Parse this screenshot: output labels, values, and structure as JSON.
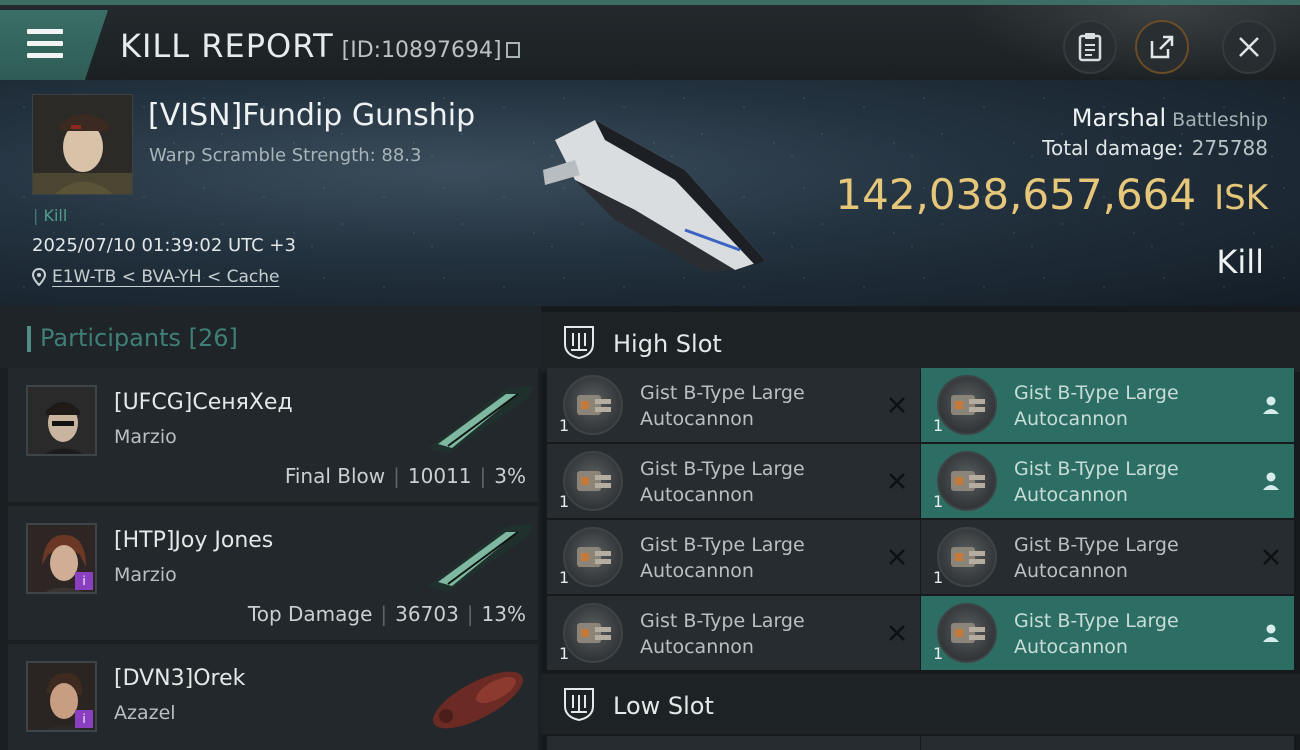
{
  "header": {
    "title": "KILL REPORT",
    "kill_id": "[ID:10897694]"
  },
  "victim": {
    "name": "[VISN]Fundip Gunship",
    "warp_scramble": "Warp Scramble Strength: 88.3",
    "tag": "Kill",
    "datetime": "2025/07/10 01:39:02 UTC +3",
    "location": "E1W-TB < BVA-YH < Cache",
    "ship_name": "Marshal",
    "ship_class": "Battleship",
    "total_damage_label": "Total damage:",
    "total_damage": "275788",
    "isk_value": "142,038,657,664",
    "isk_unit": "ISK",
    "report_type": "Kill"
  },
  "participants": {
    "label": "Participants",
    "count": "[26]",
    "items": [
      {
        "name": "[UFCG]СеняХед",
        "ship": "Marzio",
        "role": "Final Blow",
        "damage": "10011",
        "percent": "3%"
      },
      {
        "name": "[HTP]Joy Jones",
        "ship": "Marzio",
        "role": "Top Damage",
        "damage": "36703",
        "percent": "13%"
      },
      {
        "name": "[DVN3]Orek",
        "ship": "Azazel"
      }
    ]
  },
  "high_slot": {
    "label": "High Slot",
    "modules": [
      {
        "line1": "Gist B-Type Large",
        "line2": "Autocannon",
        "qty": "1",
        "status": "destroyed-x"
      },
      {
        "line1": "Gist B-Type Large",
        "line2": "Autocannon",
        "qty": "1",
        "status": "dropped-person"
      },
      {
        "line1": "Gist B-Type Large",
        "line2": "Autocannon",
        "qty": "1",
        "status": "destroyed-x"
      },
      {
        "line1": "Gist B-Type Large",
        "line2": "Autocannon",
        "qty": "1",
        "status": "dropped-person"
      },
      {
        "line1": "Gist B-Type Large",
        "line2": "Autocannon",
        "qty": "1",
        "status": "destroyed-x"
      },
      {
        "line1": "Gist B-Type Large",
        "line2": "Autocannon",
        "qty": "1",
        "status": "destroyed-x"
      },
      {
        "line1": "Gist B-Type Large",
        "line2": "Autocannon",
        "qty": "1",
        "status": "destroyed-x"
      },
      {
        "line1": "Gist B-Type Large",
        "line2": "Autocannon",
        "qty": "1",
        "status": "dropped-person"
      }
    ]
  },
  "low_slot": {
    "label": "Low Slot"
  },
  "colors": {
    "accent": "#3c6e66",
    "isk": "#e6c77a",
    "dropped_module": "#2c6e64",
    "destroyed_module": "#262c2f"
  }
}
